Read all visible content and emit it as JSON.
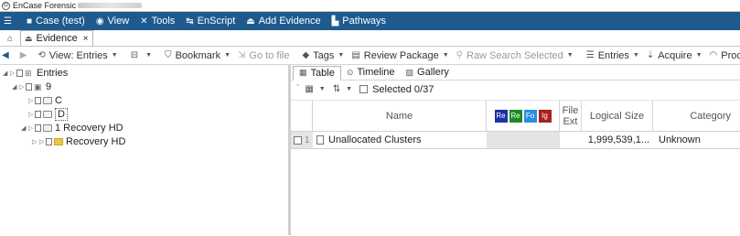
{
  "app": {
    "logo_letter": "G",
    "title": "EnCase Forensic"
  },
  "menu": [
    {
      "icon": "menu-icon",
      "glyph": "☰",
      "label": ""
    },
    {
      "icon": "case-icon",
      "glyph": "■",
      "label": "Case (test)"
    },
    {
      "icon": "eye-icon",
      "glyph": "◉",
      "label": "View"
    },
    {
      "icon": "tools-icon",
      "glyph": "✕",
      "label": "Tools"
    },
    {
      "icon": "enscript-icon",
      "glyph": "↹",
      "label": "EnScript"
    },
    {
      "icon": "add-evidence-icon",
      "glyph": "⏏",
      "label": "Add Evidence"
    },
    {
      "icon": "pathways-icon",
      "glyph": "▙",
      "label": "Pathways"
    }
  ],
  "tabs": {
    "home_glyph": "⌂",
    "active": "Evidence",
    "close": "×"
  },
  "toolbar": {
    "back": "◀",
    "forward": "▶",
    "view_label": "View: Entries",
    "bookmark_label": "Bookmark",
    "goto_label": "Go to file",
    "tags_label": "Tags",
    "review_label": "Review Package",
    "raw_search_label": "Raw Search Selected",
    "entries_label": "Entries",
    "acquire_label": "Acquire",
    "process_label": "Process"
  },
  "tree": {
    "entries": "Entries",
    "case_node": "9",
    "drive_c": "C",
    "drive_d": "D",
    "recovery_disk": "1 Recovery HD",
    "recovery_folder": "Recovery HD"
  },
  "view_tabs": {
    "table": "Table",
    "timeline": "Timeline",
    "gallery": "Gallery"
  },
  "subbar": {
    "selected": "Selected 0/37"
  },
  "columns": {
    "name": "Name",
    "flags": [
      {
        "label": "Re",
        "color": "#1c2fa8"
      },
      {
        "label": "Re",
        "color": "#1d8a23"
      },
      {
        "label": "Fo",
        "color": "#2a8ee0"
      },
      {
        "label": "Ig",
        "color": "#a82020"
      }
    ],
    "file_ext": "File Ext",
    "logical_size": "Logical Size",
    "category": "Category"
  },
  "rows": [
    {
      "num": "1",
      "name": "Unallocated Clusters",
      "file_ext": "",
      "logical_size": "1,999,539,1...",
      "category": "Unknown"
    }
  ]
}
